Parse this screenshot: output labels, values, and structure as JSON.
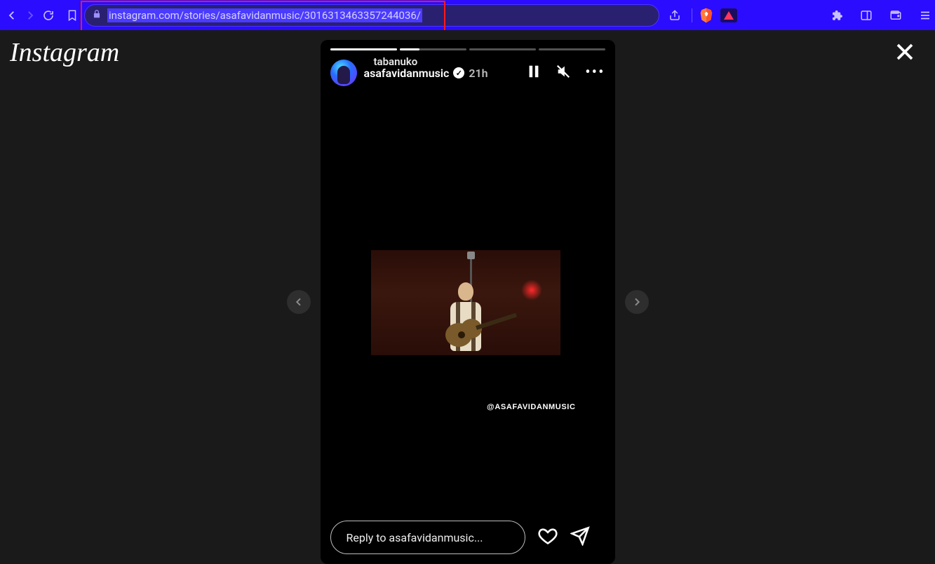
{
  "browser": {
    "url": "instagram.com/stories/asafavidanmusic/3016313463357244036/"
  },
  "page": {
    "logo": "Instagram"
  },
  "story": {
    "shared_by": "tabanuko",
    "username": "asafavidanmusic",
    "timestamp": "21h",
    "segments": 4,
    "current_segment": 1,
    "mention_tag": "@ASAFAVIDANMUSIC",
    "reply_placeholder": "Reply to asafavidanmusic..."
  }
}
